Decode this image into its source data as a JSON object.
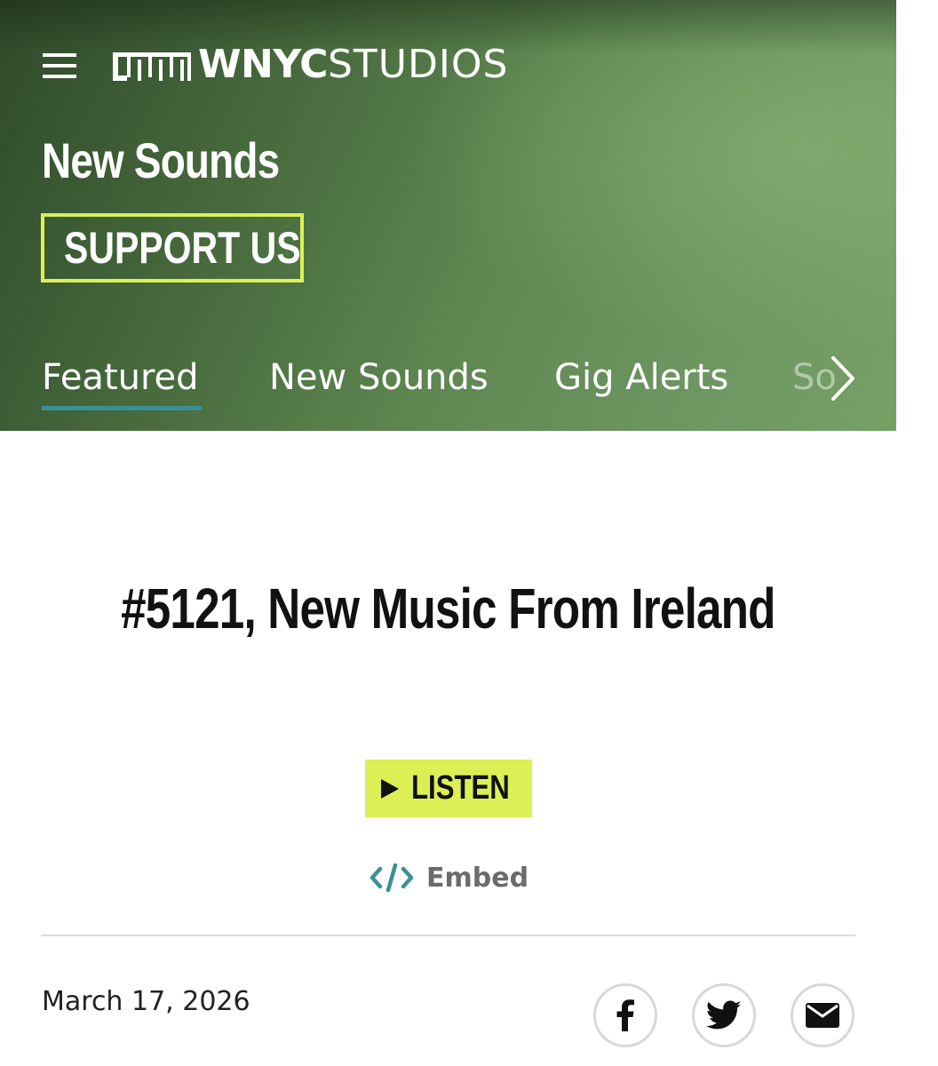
{
  "header": {
    "brand_bold": "WNYC",
    "brand_light": "STUDIOS",
    "show_title": "New Sounds",
    "support_label": "SUPPORT US",
    "tabs": [
      {
        "label": "Featured",
        "active": true
      },
      {
        "label": "New Sounds",
        "active": false
      },
      {
        "label": "Gig Alerts",
        "active": false
      },
      {
        "label": "So",
        "active": false
      }
    ],
    "accent_color": "#dcf055",
    "tab_indicator_color": "#3b8f95"
  },
  "episode": {
    "title": "#5121, New Music From Ireland",
    "listen_label": "LISTEN",
    "embed_label": "Embed",
    "date": "March 17, 2026"
  },
  "share": {
    "icons": [
      "facebook-icon",
      "twitter-icon",
      "email-icon"
    ]
  }
}
